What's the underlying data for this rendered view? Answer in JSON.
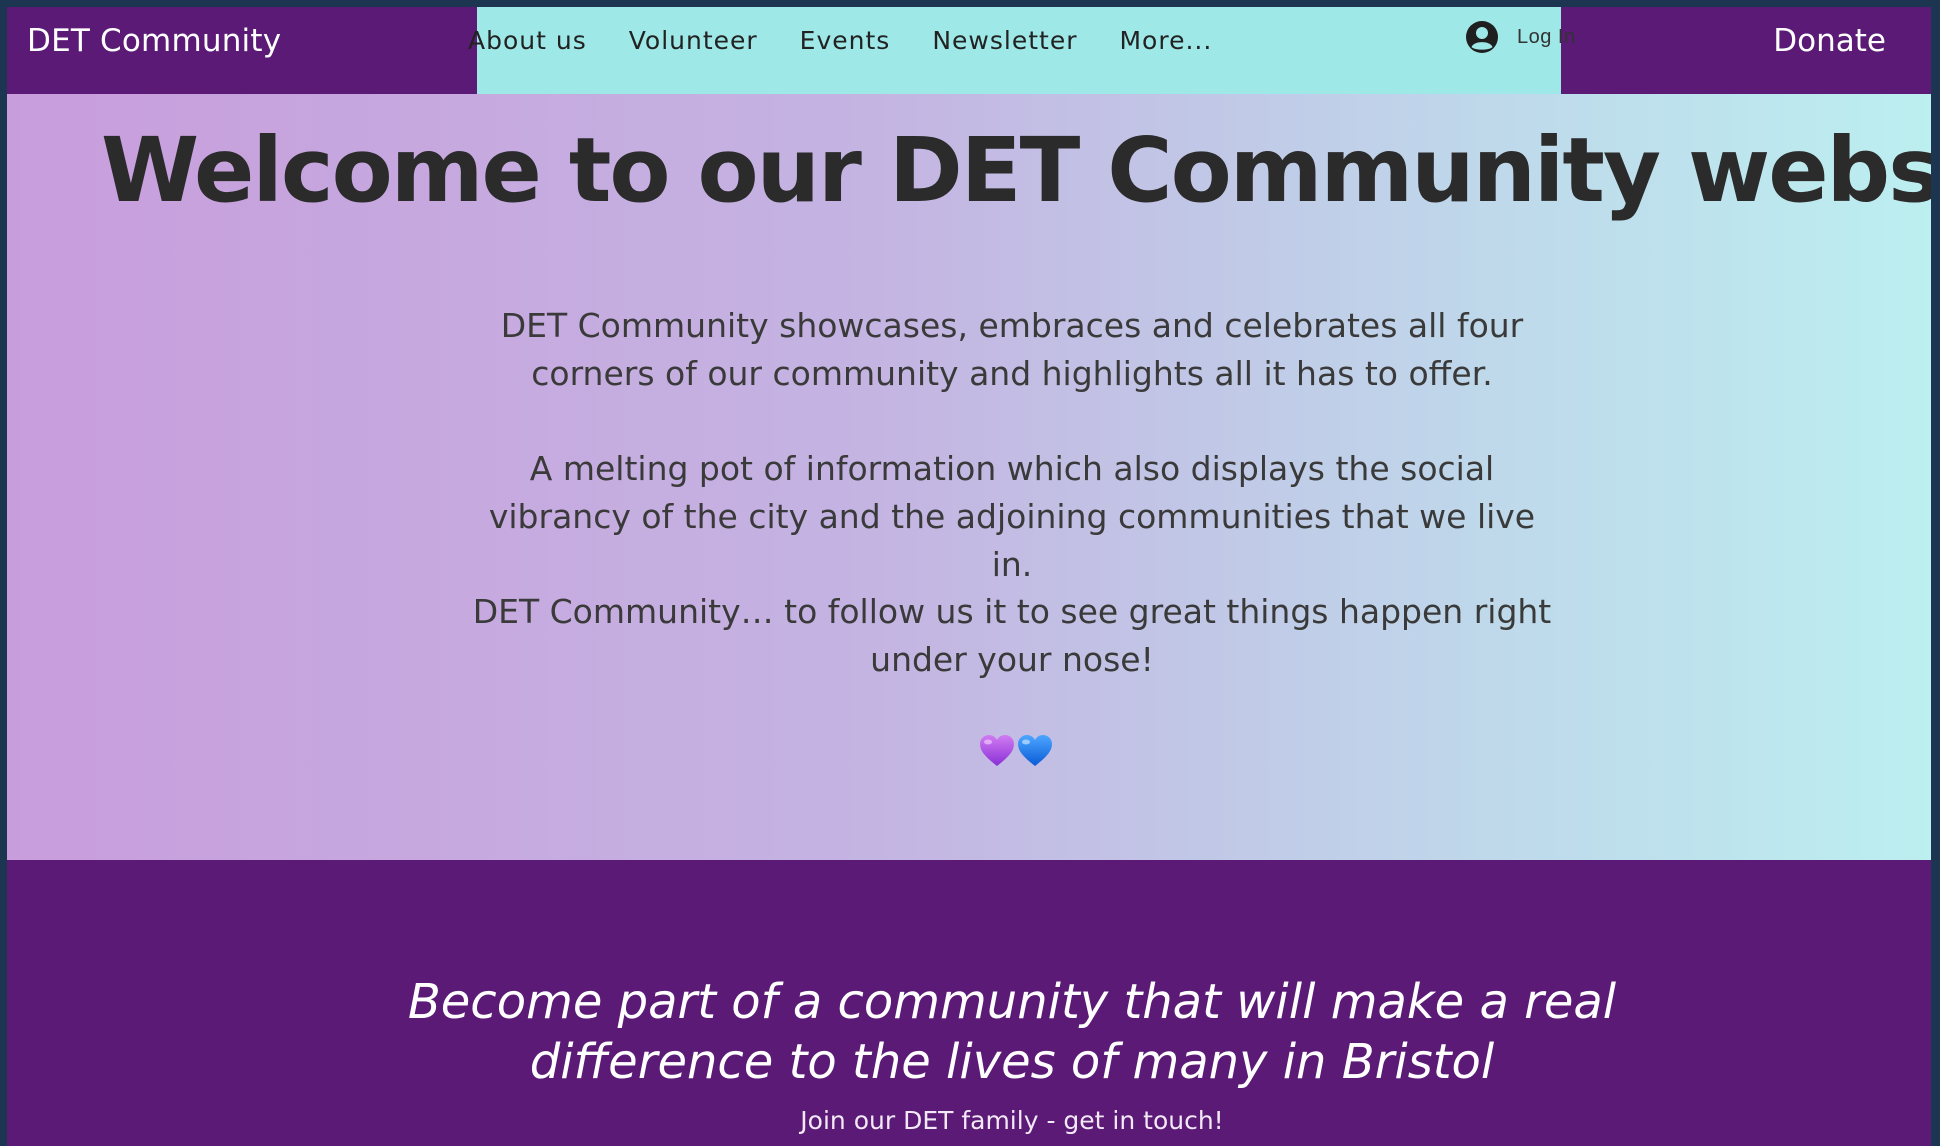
{
  "header": {
    "site_title": "DET Community",
    "nav": [
      "About us",
      "Volunteer",
      "Events",
      "Newsletter",
      "More..."
    ],
    "login_label": "Log In",
    "donate_label": "Donate"
  },
  "hero": {
    "title": "Welcome to our DET Community website!",
    "paragraphs": [
      "DET Community showcases, embraces and celebrates all four corners of our community and highlights all it has to offer.",
      "A melting pot of information which also displays the social vibrancy of the city and the adjoining communities that we live in.",
      "DET Community… to follow us it to see great things happen right under your nose!"
    ],
    "hearts": [
      "purple-heart-icon",
      "blue-heart-icon"
    ]
  },
  "join": {
    "title": "Become part of a community that will make a real difference to the lives of many in Bristol",
    "subtitle": "Join our DET family - get in touch!"
  },
  "colors": {
    "header_bg": "#5b1a75",
    "nav_band": "#9ee8e8",
    "hero_gradient_start": "#c89ddc",
    "hero_gradient_end": "#bceff0",
    "title_text": "#2b2b2b"
  }
}
